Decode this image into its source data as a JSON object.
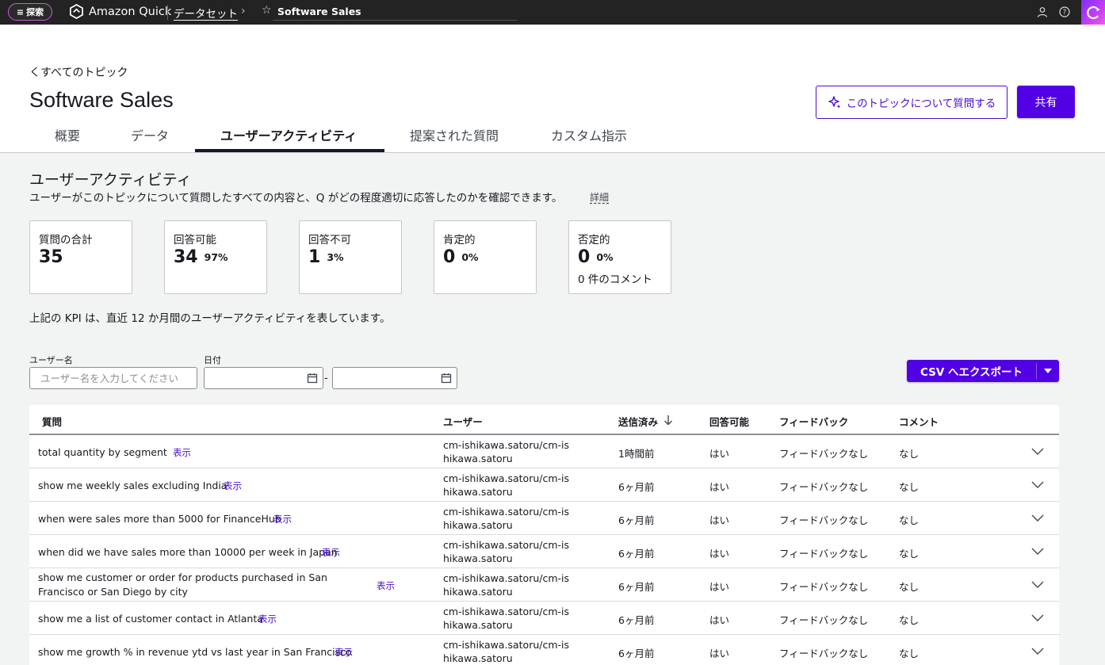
{
  "topbar": {
    "explore_label": "探索",
    "brand": "Amazon Quick",
    "crumb_dataset": "データセット",
    "crumb_current": "Software Sales"
  },
  "header": {
    "back_link": "くすべてのトピック",
    "title": "Software Sales",
    "ask_button": "このトピックについて質問する",
    "share_button": "共有"
  },
  "tabs": [
    {
      "label": "概要"
    },
    {
      "label": "データ"
    },
    {
      "label": "ユーザーアクティビティ"
    },
    {
      "label": "提案された質問"
    },
    {
      "label": "カスタム指示"
    }
  ],
  "section": {
    "title": "ユーザーアクティビティ",
    "description": "ユーザーがこのトピックについて質問したすべての内容と、Q がどの程度適切に応答したのかを確認できます。",
    "details_link": "詳細"
  },
  "kpis": [
    {
      "label": "質問の合計",
      "value": "35",
      "pct": "",
      "sub": ""
    },
    {
      "label": "回答可能",
      "value": "34",
      "pct": "97%",
      "sub": ""
    },
    {
      "label": "回答不可",
      "value": "1",
      "pct": "3%",
      "sub": ""
    },
    {
      "label": "肯定的",
      "value": "0",
      "pct": "0%",
      "sub": ""
    },
    {
      "label": "否定的",
      "value": "0",
      "pct": "0%",
      "sub": "0 件のコメント"
    }
  ],
  "kpi_note": "上記の KPI は、直近 12 か月間のユーザーアクティビティを表しています。",
  "filters": {
    "username_label": "ユーザー名",
    "username_placeholder": "ユーザー名を入力してください",
    "date_label": "日付",
    "date_separator": "-"
  },
  "export": {
    "csv_label": "CSV へエクスポート"
  },
  "table": {
    "columns": {
      "question": "質問",
      "user": "ユーザー",
      "sent": "送信済み",
      "answerable": "回答可能",
      "feedback": "フィードバック",
      "comment": "コメント"
    },
    "show_label": "表示",
    "rows": [
      {
        "question": "total quantity by segment",
        "user": "cm-ishikawa.satoru/cm-ishikawa.satoru",
        "sent": "1時間前",
        "answerable": "はい",
        "feedback": "フィードバックなし",
        "comment": "なし"
      },
      {
        "question": "show me weekly sales excluding India",
        "user": "cm-ishikawa.satoru/cm-ishikawa.satoru",
        "sent": "6ヶ月前",
        "answerable": "はい",
        "feedback": "フィードバックなし",
        "comment": "なし"
      },
      {
        "question": "when were sales more than 5000 for FinanceHub",
        "user": "cm-ishikawa.satoru/cm-ishikawa.satoru",
        "sent": "6ヶ月前",
        "answerable": "はい",
        "feedback": "フィードバックなし",
        "comment": "なし"
      },
      {
        "question": "when did we have sales more than 10000 per week in Japan",
        "user": "cm-ishikawa.satoru/cm-ishikawa.satoru",
        "sent": "6ヶ月前",
        "answerable": "はい",
        "feedback": "フィードバックなし",
        "comment": "なし"
      },
      {
        "question": "show me customer or order for products purchased in San Francisco or San Diego by city",
        "user": "cm-ishikawa.satoru/cm-ishikawa.satoru",
        "sent": "6ヶ月前",
        "answerable": "はい",
        "feedback": "フィードバックなし",
        "comment": "なし"
      },
      {
        "question": "show me a list of customer contact in Atlanta",
        "user": "cm-ishikawa.satoru/cm-ishikawa.satoru",
        "sent": "6ヶ月前",
        "answerable": "はい",
        "feedback": "フィードバックなし",
        "comment": "なし"
      },
      {
        "question": "show me growth % in revenue ytd vs last year in San Francisco",
        "user": "cm-ishikawa.satoru/cm-ishikawa.satoru",
        "sent": "6ヶ月前",
        "answerable": "はい",
        "feedback": "フィードバックなし",
        "comment": "なし"
      }
    ]
  }
}
